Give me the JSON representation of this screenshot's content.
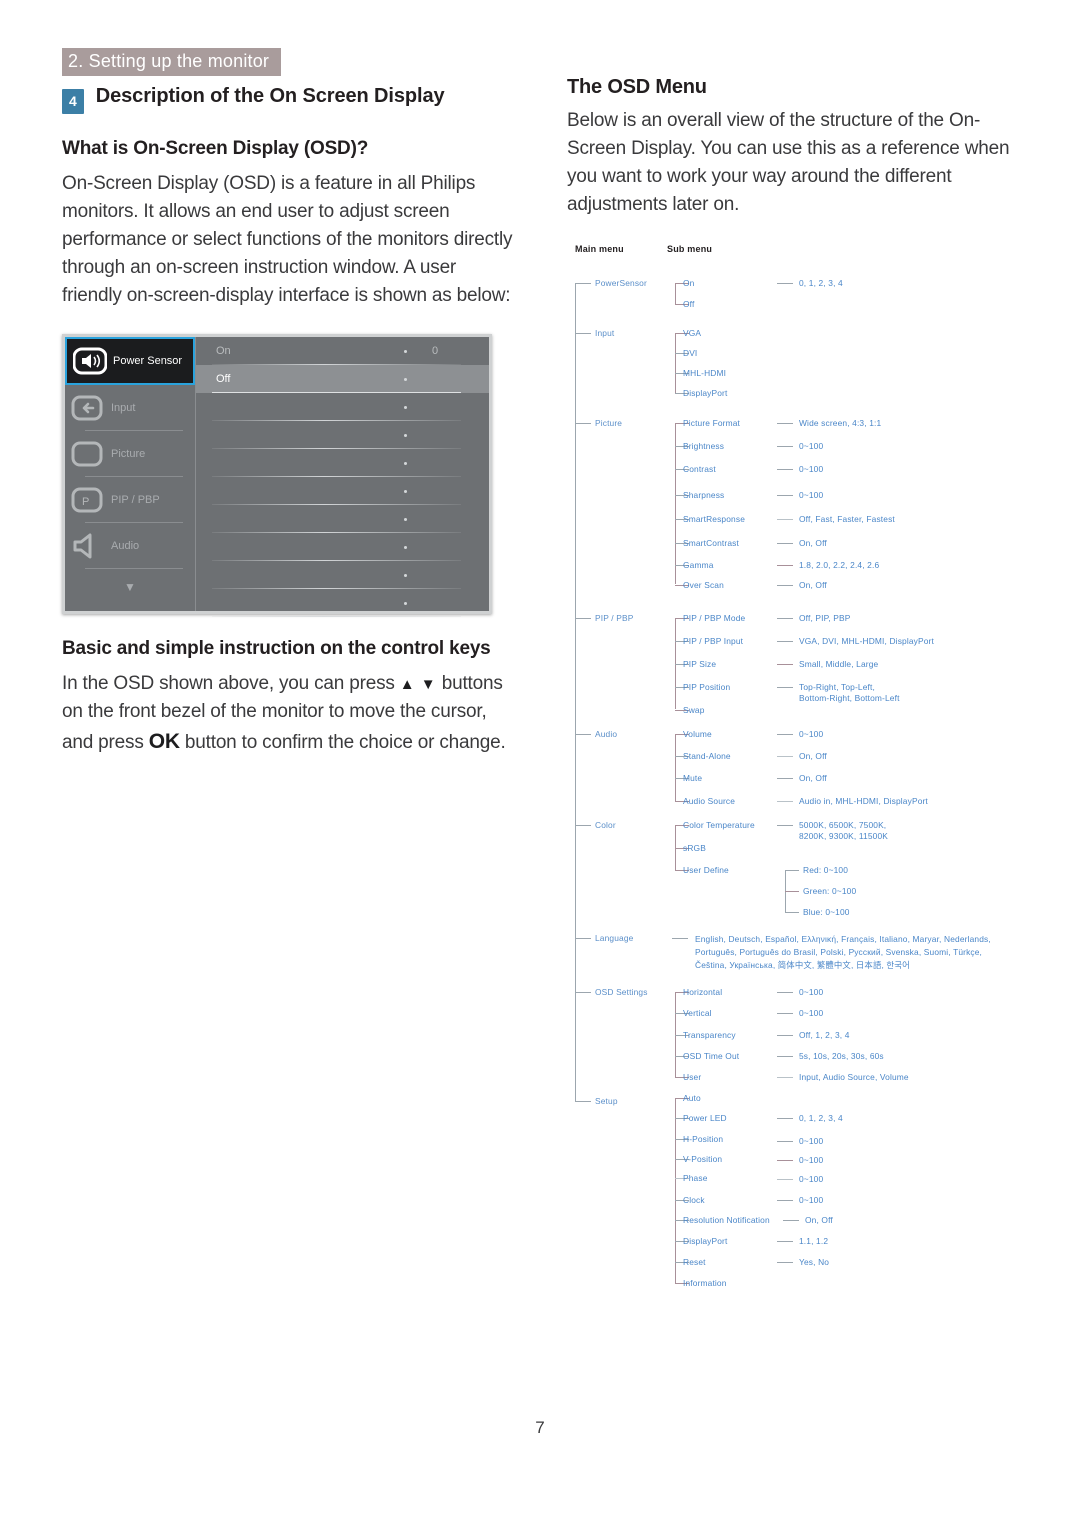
{
  "header": {
    "chapter": "2. Setting up the monitor"
  },
  "left": {
    "section_number": "4",
    "section_title": "Description of the On Screen Display",
    "heading_1": "What is On-Screen Display (OSD)?",
    "paragraph_1": "On-Screen Display (OSD) is a feature in all Philips monitors. It allows an end user to adjust screen performance or select functions of the monitors directly through an on-screen instruction window. A user friendly on-screen-display interface is shown as below:",
    "heading_2": "Basic and simple instruction on the control keys",
    "paragraph_2_part1": "In the OSD shown above, you can press ",
    "paragraph_2_arrows": "▲ ▼",
    "paragraph_2_part2": " buttons on the front bezel of the monitor to move the cursor, and press ",
    "paragraph_2_ok": "OK",
    "paragraph_2_part3": " button to confirm the choice or change."
  },
  "right": {
    "heading": "The OSD Menu",
    "paragraph": "Below is an overall view of the structure of the On-Screen Display. You can use this as a reference when you want to work your way around the different adjustments later on."
  },
  "osd_screenshot": {
    "menu_items": [
      {
        "label": "Power Sensor",
        "icon": "power-sensor-icon",
        "selected": true
      },
      {
        "label": "Input",
        "icon": "input-arrow-icon",
        "selected": false
      },
      {
        "label": "Picture",
        "icon": "picture-icon",
        "selected": false
      },
      {
        "label": "PIP / PBP",
        "icon": "pip-pbp-icon",
        "selected": false
      },
      {
        "label": "Audio",
        "icon": "speaker-icon",
        "selected": false
      }
    ],
    "scroll_down_icon": "chevron-down-icon",
    "rows": [
      {
        "label": "On",
        "value": "0",
        "highlighted": false
      },
      {
        "label": "Off",
        "value": "",
        "highlighted": true
      }
    ],
    "blank_row_count": 8,
    "accent_color": "#2aa3dd"
  },
  "tree": {
    "col_header_main": "Main menu",
    "col_header_sub": "Sub menu",
    "menus": [
      {
        "name": "PowerSensor",
        "items": [
          {
            "label": "On",
            "values": "0, 1, 2, 3, 4"
          },
          {
            "label": "Off",
            "values": ""
          }
        ]
      },
      {
        "name": "Input",
        "items": [
          {
            "label": "VGA",
            "values": ""
          },
          {
            "label": "DVI",
            "values": ""
          },
          {
            "label": "MHL-HDMI",
            "values": ""
          },
          {
            "label": "DisplayPort",
            "values": ""
          }
        ]
      },
      {
        "name": "Picture",
        "items": [
          {
            "label": "Picture Format",
            "values": "Wide screen, 4:3, 1:1"
          },
          {
            "label": "Brightness",
            "values": "0~100"
          },
          {
            "label": "Contrast",
            "values": "0~100"
          },
          {
            "label": "Sharpness",
            "values": "0~100"
          },
          {
            "label": "SmartResponse",
            "values": "Off, Fast, Faster, Fastest"
          },
          {
            "label": "SmartContrast",
            "values": "On, Off"
          },
          {
            "label": "Gamma",
            "values": "1.8, 2.0, 2.2, 2.4, 2.6"
          },
          {
            "label": "Over Scan",
            "values": "On, Off"
          }
        ]
      },
      {
        "name": "PIP / PBP",
        "items": [
          {
            "label": "PIP / PBP Mode",
            "values": "Off, PIP, PBP"
          },
          {
            "label": "PIP / PBP Input",
            "values": "VGA, DVI, MHL-HDMI, DisplayPort"
          },
          {
            "label": "PIP Size",
            "values": "Small, Middle, Large"
          },
          {
            "label": "PIP Position",
            "values": "Top-Right, Top-Left,\nBottom-Right, Bottom-Left"
          },
          {
            "label": "Swap",
            "values": ""
          }
        ]
      },
      {
        "name": "Audio",
        "items": [
          {
            "label": "Volume",
            "values": "0~100"
          },
          {
            "label": "Stand-Alone",
            "values": "On, Off"
          },
          {
            "label": "Mute",
            "values": "On, Off"
          },
          {
            "label": "Audio Source",
            "values": "Audio in, MHL-HDMI, DisplayPort"
          }
        ]
      },
      {
        "name": "Color",
        "items": [
          {
            "label": "Color Temperature",
            "values": "5000K, 6500K, 7500K,\n8200K, 9300K, 11500K"
          },
          {
            "label": "sRGB",
            "values": ""
          },
          {
            "label": "User Define",
            "values": ""
          }
        ],
        "sub_items": [
          {
            "label": "Red: 0~100"
          },
          {
            "label": "Green: 0~100"
          },
          {
            "label": "Blue: 0~100"
          }
        ]
      },
      {
        "name": "Language",
        "items": [
          {
            "label": "English, Deutsch, Español, Ελληνική, Français, Italiano, Maryar, Nederlands,\nPortuguês, Português do Brasil, Polski, Русский, Svenska, Suomi, Türkçe,\nČeština, Українська, 简体中文, 繁體中文, 日本語, 한국어",
            "values": ""
          }
        ]
      },
      {
        "name": "OSD Settings",
        "items": [
          {
            "label": "Horizontal",
            "values": "0~100"
          },
          {
            "label": "Vertical",
            "values": "0~100"
          },
          {
            "label": "Transparency",
            "values": "Off, 1, 2, 3, 4"
          },
          {
            "label": "OSD Time Out",
            "values": "5s, 10s, 20s, 30s, 60s"
          },
          {
            "label": "User",
            "values": "Input, Audio Source, Volume"
          }
        ]
      },
      {
        "name": "Setup",
        "items": [
          {
            "label": "Auto",
            "values": ""
          },
          {
            "label": "Power LED",
            "values": "0, 1, 2, 3, 4"
          },
          {
            "label": "H-Position",
            "values": "0~100"
          },
          {
            "label": "V-Position",
            "values": "0~100"
          },
          {
            "label": "Phase",
            "values": "0~100"
          },
          {
            "label": "Clock",
            "values": "0~100"
          },
          {
            "label": "Resolution Notification",
            "values": "On, Off"
          },
          {
            "label": "DisplayPort",
            "values": "1.1, 1.2"
          },
          {
            "label": "Reset",
            "values": "Yes, No"
          },
          {
            "label": "Information",
            "values": ""
          }
        ]
      }
    ]
  },
  "footer": {
    "page_number": "7"
  },
  "colors": {
    "chapter_band": "#a99c9c",
    "section_number_box": "#3c7fa6",
    "tree_text": "#5b8fc9",
    "osd_highlight": "#2aa3dd"
  }
}
